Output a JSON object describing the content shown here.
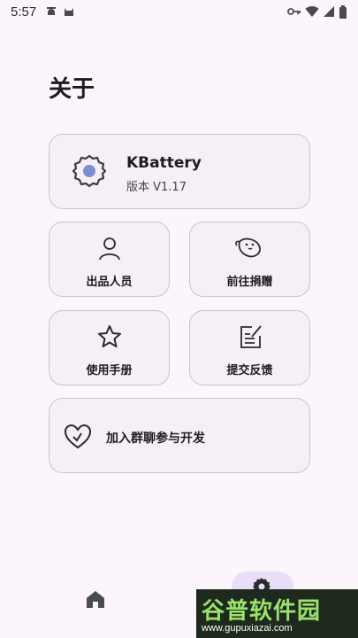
{
  "status_bar": {
    "time": "5:57",
    "icons": [
      "android-debug-icon",
      "cat-icon",
      "key-icon",
      "wifi-icon",
      "signal-icon",
      "battery-icon"
    ]
  },
  "page": {
    "title": "关于"
  },
  "app_card": {
    "icon": "gear-icon",
    "name": "KBattery",
    "version": "版本 V1.17"
  },
  "grid": [
    {
      "icon": "person-icon",
      "label": "出品人员"
    },
    {
      "icon": "tadpole-icon",
      "label": "前往捐赠"
    },
    {
      "icon": "star-icon",
      "label": "使用手册"
    },
    {
      "icon": "edit-note-icon",
      "label": "提交反馈"
    }
  ],
  "wide_card": {
    "icon": "heart-icon",
    "label": "加入群聊参与开发"
  },
  "bottom_nav": {
    "items": [
      {
        "icon": "home-icon"
      },
      {
        "icon": "settings-icon",
        "selected": true
      }
    ]
  },
  "watermark": {
    "main": "谷普软件园",
    "url": "www.gupuxiazai.com"
  },
  "colors": {
    "background": "#FCF6FC",
    "card": "#F5F0F5",
    "accent": "#7C8FD0",
    "nav_pill": "#E8DEF8"
  }
}
